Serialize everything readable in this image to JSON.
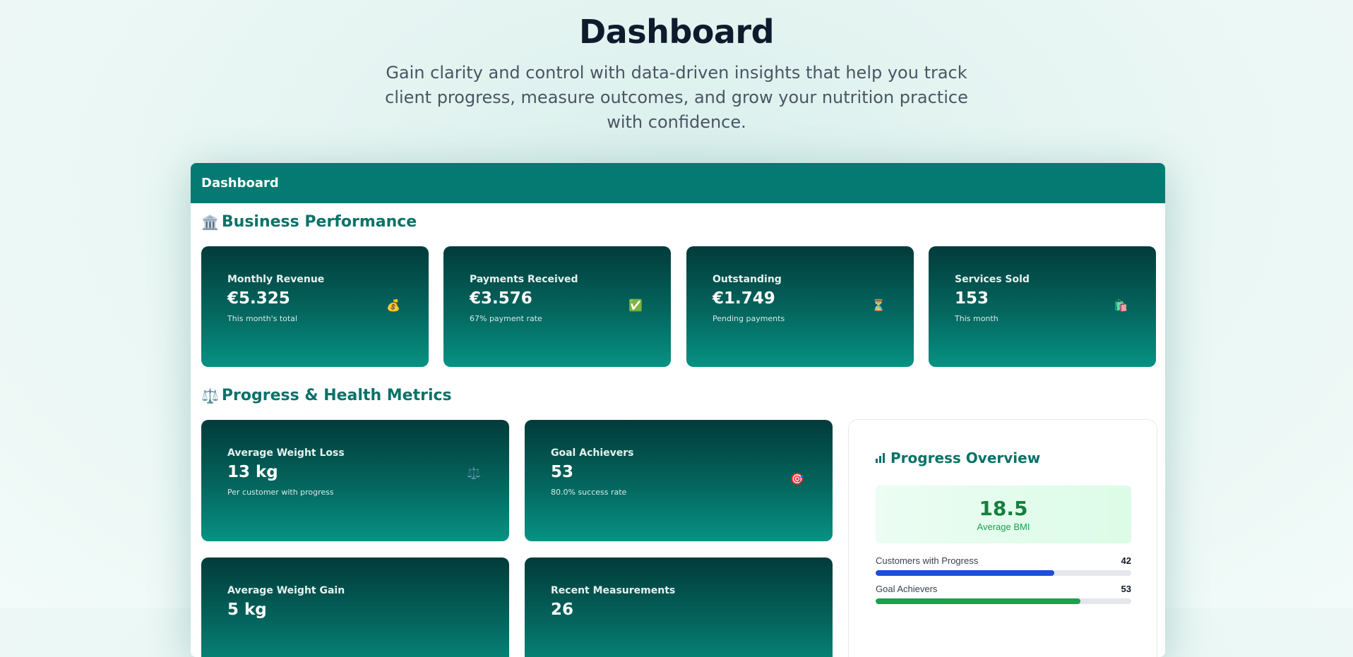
{
  "hero": {
    "title": "Dashboard",
    "subtitle": "Gain clarity and control with data-driven insights that help you track client progress, measure outcomes, and grow your nutrition practice with confidence."
  },
  "panel": {
    "header": "Dashboard",
    "business": {
      "icon": "bank-icon",
      "title": "Business Performance",
      "cards": [
        {
          "label": "Monthly Revenue",
          "value": "€5.325",
          "sub": "This month's total",
          "icon": "money-bag-icon",
          "emoji": "💰"
        },
        {
          "label": "Payments Received",
          "value": "€3.576",
          "sub": "67% payment rate",
          "icon": "check-mark-icon",
          "emoji": "✅"
        },
        {
          "label": "Outstanding",
          "value": "€1.749",
          "sub": "Pending payments",
          "icon": "hourglass-icon",
          "emoji": "⏳"
        },
        {
          "label": "Services Sold",
          "value": "153",
          "sub": "This month",
          "icon": "shopping-bags-icon",
          "emoji": "🛍️"
        }
      ]
    },
    "progress": {
      "icon": "scales-icon",
      "title": "Progress & Health Metrics",
      "cards": [
        {
          "label": "Average Weight Loss",
          "value": "13 kg",
          "sub": "Per customer with progress",
          "icon": "scales-icon",
          "emoji": "⚖️"
        },
        {
          "label": "Goal Achievers",
          "value": "53",
          "sub": "80.0% success rate",
          "icon": "target-icon",
          "emoji": "🎯"
        },
        {
          "label": "Average Weight Gain",
          "value": "5 kg",
          "sub": "",
          "icon": "",
          "emoji": ""
        },
        {
          "label": "Recent Measurements",
          "value": "26",
          "sub": "",
          "icon": "",
          "emoji": ""
        }
      ]
    },
    "overview": {
      "title": "Progress Overview",
      "icon": "bar-chart-icon",
      "bmi_value": "18.5",
      "bmi_label": "Average BMI",
      "metrics": [
        {
          "label": "Customers with Progress",
          "value": "42",
          "fill": 0.7,
          "color": "#1d4ed8"
        },
        {
          "label": "Goal Achievers",
          "value": "53",
          "fill": 0.8,
          "color": "#16a34a"
        }
      ]
    }
  }
}
